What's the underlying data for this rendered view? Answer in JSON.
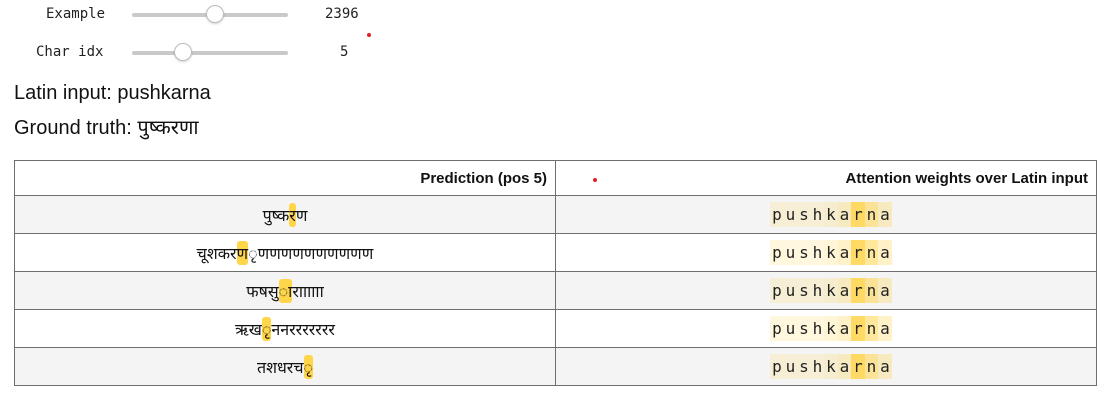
{
  "controls": {
    "example": {
      "label": "Example",
      "value": "2396",
      "fraction": 0.53
    },
    "char_idx": {
      "label": "Char idx",
      "value": "5",
      "fraction": 0.33
    }
  },
  "info": {
    "latin_input": "Latin input: pushkarna",
    "ground_truth": "Ground truth: पुष्करणा"
  },
  "table": {
    "headers": {
      "prediction": "Prediction (pos 5)",
      "attention": "Attention weights over Latin input"
    },
    "latin_chars": [
      "p",
      "u",
      "s",
      "h",
      "k",
      "a",
      "r",
      "n",
      "a"
    ],
    "attention_weights": [
      0.18,
      0.18,
      0.18,
      0.18,
      0.22,
      0.3,
      0.85,
      0.55,
      0.3
    ],
    "highlight_color": "#ffd54a",
    "rows": [
      {
        "prefix": "पुष्क",
        "highlight": "र",
        "suffix": "ण"
      },
      {
        "prefix": "चूशकर",
        "highlight": "ण",
        "suffix": "ृणणणणणणणणणण"
      },
      {
        "prefix": "फषसु",
        "highlight": "ा",
        "suffix": "राााााा"
      },
      {
        "prefix": "ऋख",
        "highlight": "ृ",
        "suffix": "ननररररररर"
      },
      {
        "prefix": "तशधरच",
        "highlight": "ृ",
        "suffix": ""
      }
    ]
  }
}
